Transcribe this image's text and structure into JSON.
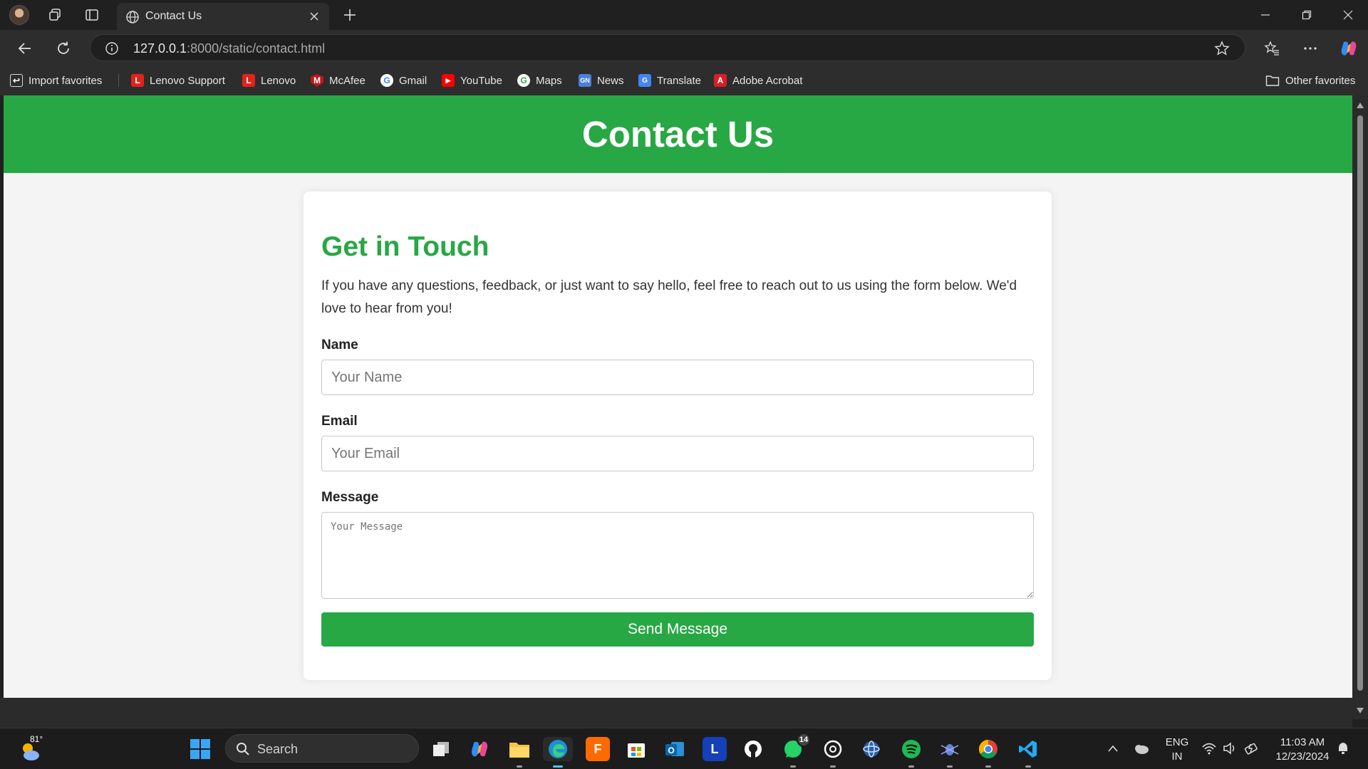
{
  "browser": {
    "tab_title": "Contact Us",
    "url_host": "127.0.0.1",
    "url_rest": ":8000/static/contact.html",
    "favorites": [
      {
        "label": "Import favorites",
        "icon": "import-icon"
      },
      {
        "label": "Lenovo Support",
        "icon": "lenovo-icon"
      },
      {
        "label": "Lenovo",
        "icon": "lenovo-icon"
      },
      {
        "label": "McAfee",
        "icon": "mcafee-icon"
      },
      {
        "label": "Gmail",
        "icon": "google-icon"
      },
      {
        "label": "YouTube",
        "icon": "youtube-icon"
      },
      {
        "label": "Maps",
        "icon": "google-icon"
      },
      {
        "label": "News",
        "icon": "news-icon"
      },
      {
        "label": "Translate",
        "icon": "translate-icon"
      },
      {
        "label": "Adobe Acrobat",
        "icon": "acrobat-icon"
      }
    ],
    "other_favorites": "Other favorites"
  },
  "page": {
    "header_title": "Contact Us",
    "heading": "Get in Touch",
    "intro": "If you have any questions, feedback, or just want to say hello, feel free to reach out to us using the form below. We'd love to hear from you!",
    "name_label": "Name",
    "name_placeholder": "Your Name",
    "email_label": "Email",
    "email_placeholder": "Your Email",
    "message_label": "Message",
    "message_placeholder": "Your Message",
    "submit_label": "Send Message"
  },
  "taskbar": {
    "weather_temp": "81°",
    "search_label": "Search",
    "whatsapp_badge": "14",
    "language_line1": "ENG",
    "language_line2": "IN",
    "time": "11:03 AM",
    "date": "12/23/2024"
  },
  "colors": {
    "accent_green": "#28a745",
    "chrome_dark": "#202020",
    "page_bg": "#f4f4f4"
  }
}
